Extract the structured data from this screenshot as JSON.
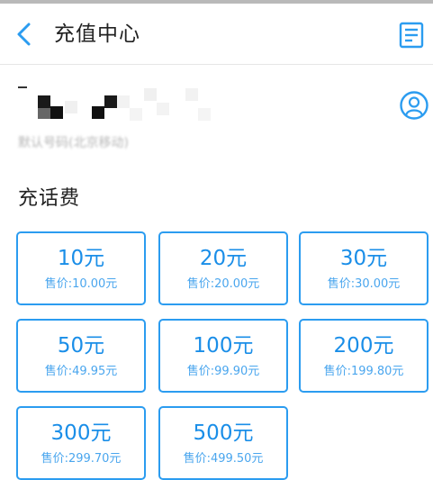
{
  "header": {
    "title": "充值中心",
    "back_icon": "chevron-left-icon",
    "records_icon": "document-list-icon"
  },
  "account": {
    "number_label": "默认号码(北京移动)",
    "avatar_icon": "user-circle-icon"
  },
  "section": {
    "title": "充话费"
  },
  "tiles": [
    {
      "amount": "10元",
      "price": "售价:10.00元"
    },
    {
      "amount": "20元",
      "price": "售价:20.00元"
    },
    {
      "amount": "30元",
      "price": "售价:30.00元"
    },
    {
      "amount": "50元",
      "price": "售价:49.95元"
    },
    {
      "amount": "100元",
      "price": "售价:99.90元"
    },
    {
      "amount": "200元",
      "price": "售价:199.80元"
    },
    {
      "amount": "300元",
      "price": "售价:299.70元"
    },
    {
      "amount": "500元",
      "price": "售价:499.50元"
    }
  ],
  "colors": {
    "accent": "#1a8ee8",
    "border": "#2b9cf0",
    "price_text": "#4aa6ee",
    "muted": "#b5b5b5"
  }
}
